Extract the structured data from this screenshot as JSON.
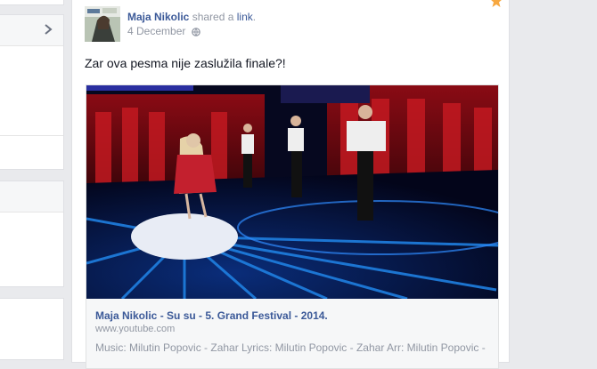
{
  "post": {
    "author": "Maja Nikolic",
    "shared_text": " shared a ",
    "link_word": "link",
    "period": ".",
    "date": "4 December",
    "message": "Zar ova pesma nije zaslužila finale?!"
  },
  "shared_link": {
    "title": "Maja Nikolic - Su su - 5. Grand Festival - 2014.",
    "domain": "www.youtube.com",
    "description": "Music: Milutin Popovic - Zahar Lyrics: Milutin Popovic - Zahar Arr: Milutin Popovic -"
  },
  "colors": {
    "link_blue": "#3b5998",
    "meta_gray": "#9197a3",
    "star_orange": "#f7a840"
  },
  "icons": [
    "chevron-right-icon",
    "globe-icon",
    "star-icon"
  ]
}
